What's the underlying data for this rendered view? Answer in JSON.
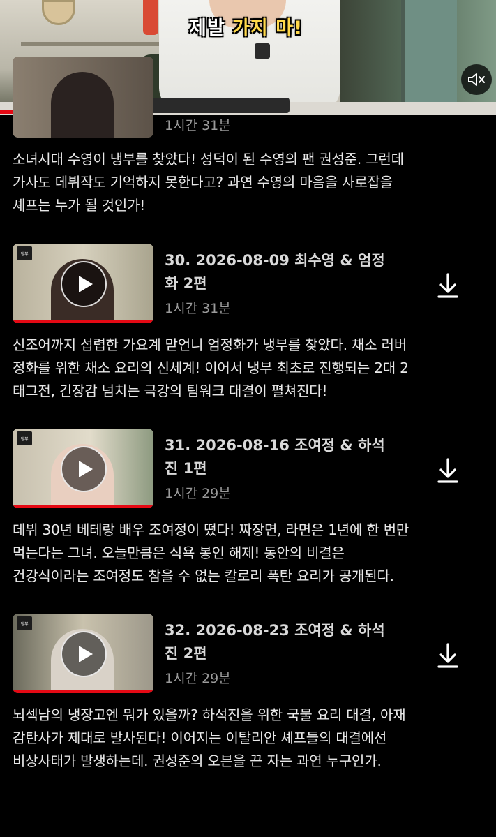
{
  "hero": {
    "caption_part1": "제발 ",
    "caption_part2": "가지 마!",
    "mute_icon": "volume-mute-icon",
    "progress_percent": 9,
    "colors": {
      "accent": "#e50914",
      "caption_highlight": "#ffd84a"
    }
  },
  "partial_episode": {
    "duration": "1시간 31분",
    "description": "소녀시대 수영이 냉부를 찾았다! 성덕이 된 수영의 팬 권성준. 그런데\n가사도 데뷔작도 기억하지 못한다고? 과연 수영의 마음을 사로잡을\n셰프는 누가 될 것인가!"
  },
  "episodes": [
    {
      "title": "30. 2026-08-09 최수영 & 엄정화 2편",
      "duration": "1시간 31분",
      "description": "신조어까지 섭렵한 가요계 맏언니 엄정화가 냉부를 찾았다. 채소 러버\n정화를 위한 채소 요리의 신세계! 이어서 냉부 최초로 진행되는 2대 2\n태그전, 긴장감 넘치는 극강의 팀워크 대결이 펼쳐진다!",
      "watched_fraction": 1.0
    },
    {
      "title": "31. 2026-08-16 조여정 & 하석진 1편",
      "duration": "1시간 29분",
      "description": "데뷔 30년 베테랑 배우 조여정이 떴다! 짜장면, 라면은 1년에 한 번만\n먹는다는 그녀. 오늘만큼은 식욕 봉인 해제! 동안의 비결은\n건강식이라는 조여정도 참을 수 없는 칼로리 폭탄 요리가 공개된다.",
      "watched_fraction": 1.0
    },
    {
      "title": "32. 2026-08-23 조여정 & 하석진 2편",
      "duration": "1시간 29분",
      "description": "뇌섹남의 냉장고엔 뭐가 있을까? 하석진을 위한 국물 요리 대결, 아재\n감탄사가 제대로 발사된다! 이어지는 이탈리안 셰프들의 대결에선\n비상사태가 발생하는데. 권성준의 오븐을 끈 자는 과연 누구인가.",
      "watched_fraction": 1.0
    }
  ],
  "icons": {
    "play": "play-icon",
    "download": "download-icon"
  }
}
